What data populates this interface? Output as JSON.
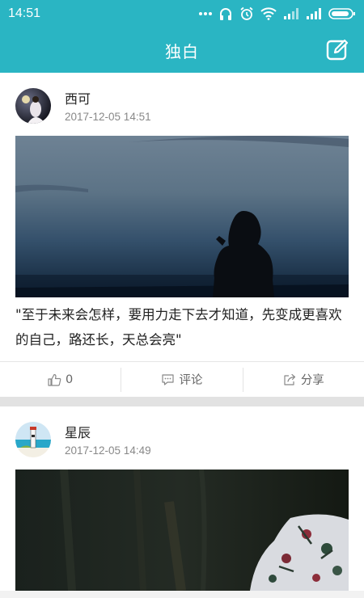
{
  "status_bar": {
    "time": "14:51",
    "icons": [
      "more-dots-icon",
      "headphones-icon",
      "alarm-icon",
      "wifi-icon",
      "signal-icon",
      "signal-icon",
      "battery-icon"
    ]
  },
  "header": {
    "title": "独白",
    "edit_icon": "edit-icon"
  },
  "posts": [
    {
      "author": "西可",
      "time": "2017-12-05 14:51",
      "image": "silhouette-at-dusk",
      "text": "\"至于未来会怎样，要用力走下去才知道，先变成更喜欢的自己，路还长，天总会亮\"",
      "like_count": "0",
      "comment_label": "评论",
      "share_label": "分享"
    },
    {
      "author": "星辰",
      "time": "2017-12-05 14:49",
      "image": "floral-dress-in-dark"
    }
  ],
  "colors": {
    "accent": "#2ab5c3",
    "background": "#f2f2f2",
    "secondary_text": "#888888"
  }
}
